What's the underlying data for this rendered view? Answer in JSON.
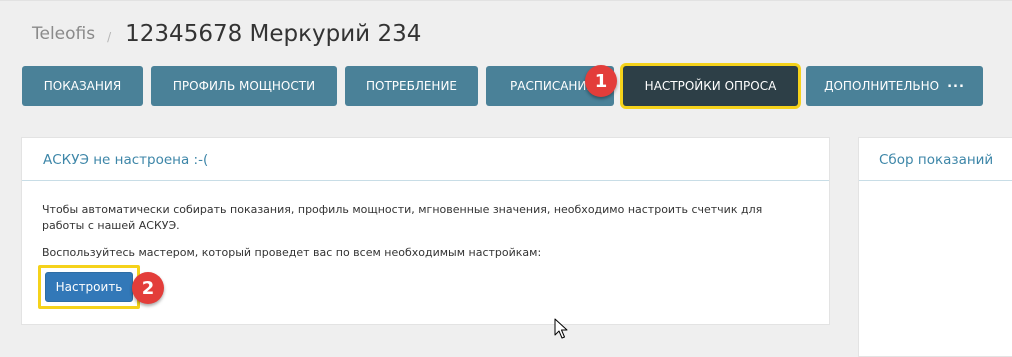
{
  "breadcrumb": {
    "root": "Teleofis",
    "separator": "/",
    "title": "12345678 Меркурий 234"
  },
  "tabs": [
    {
      "label": "ПОКАЗАНИЯ",
      "active": false
    },
    {
      "label": "ПРОФИЛЬ МОЩНОСТИ",
      "active": false
    },
    {
      "label": "ПОТРЕБЛЕНИЕ",
      "active": false
    },
    {
      "label": "РАСПИСАНИЯ",
      "active": false
    },
    {
      "label": "НАСТРОЙКИ ОПРОСА",
      "active": true
    },
    {
      "label": "ДОПОЛНИТЕЛЬНО",
      "active": false
    }
  ],
  "more_icon": "more-dots-icon",
  "markers": [
    "1",
    "2"
  ],
  "main_panel": {
    "title": "АСКУЭ не настроена :-(",
    "text_1": "Чтобы автоматически собирать показания, профиль мощности, мгновенные значения, необходимо настроить счетчик для работы с нашей АСКУЭ.",
    "text_2": "Воспользуйтесь мастером, который проведет вас по всем необходимым настройкам:",
    "setup_button": "Настроить"
  },
  "side_panel": {
    "title": "Сбор показаний"
  },
  "colors": {
    "tab": "#4a8198",
    "tab_active": "#2d3f47",
    "highlight": "#f5d21b",
    "marker": "#e33d3a",
    "button": "#3278b8",
    "link_title": "#3d86a8"
  }
}
